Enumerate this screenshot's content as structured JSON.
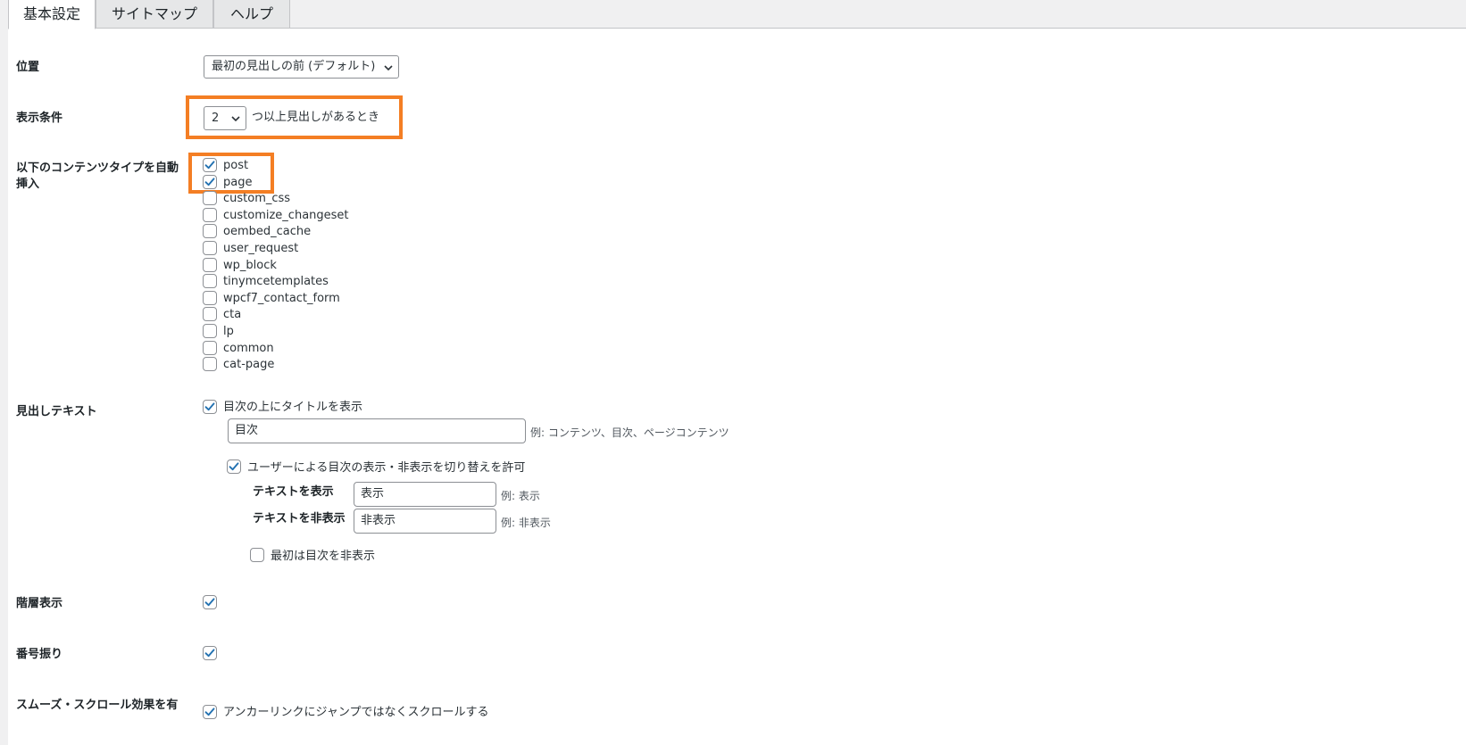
{
  "tabs": [
    "基本設定",
    "サイトマップ",
    "ヘルプ"
  ],
  "active_tab": "基本設定",
  "position": {
    "label": "位置",
    "selected": "最初の見出しの前 (デフォルト)"
  },
  "display_condition": {
    "label": "表示条件",
    "selected": "2",
    "suffix": "つ以上見出しがあるとき"
  },
  "content_types": {
    "label": "以下のコンテンツタイプを自動挿入",
    "items": [
      {
        "name": "post",
        "checked": true
      },
      {
        "name": "page",
        "checked": true
      },
      {
        "name": "custom_css",
        "checked": false
      },
      {
        "name": "customize_changeset",
        "checked": false
      },
      {
        "name": "oembed_cache",
        "checked": false
      },
      {
        "name": "user_request",
        "checked": false
      },
      {
        "name": "wp_block",
        "checked": false
      },
      {
        "name": "tinymcetemplates",
        "checked": false
      },
      {
        "name": "wpcf7_contact_form",
        "checked": false
      },
      {
        "name": "cta",
        "checked": false
      },
      {
        "name": "lp",
        "checked": false
      },
      {
        "name": "common",
        "checked": false
      },
      {
        "name": "cat-page",
        "checked": false
      }
    ]
  },
  "heading_text": {
    "label": "見出しテキスト",
    "show_title_label": "目次の上にタイトルを表示",
    "show_title_checked": true,
    "title_value": "目次",
    "title_hint": "例: コンテンツ、目次、ページコンテンツ",
    "toggle_label": "ユーザーによる目次の表示・非表示を切り替えを許可",
    "toggle_checked": true,
    "show_text_label": "テキストを表示",
    "show_text_value": "表示",
    "show_text_hint": "例: 表示",
    "hide_text_label": "テキストを非表示",
    "hide_text_value": "非表示",
    "hide_text_hint": "例: 非表示",
    "initially_hidden_label": "最初は目次を非表示",
    "initially_hidden_checked": false
  },
  "hierarchy": {
    "label": "階層表示",
    "checked": true
  },
  "numbering": {
    "label": "番号振り",
    "checked": true
  },
  "smooth_scroll": {
    "label": "スムーズ・スクロール効果を有",
    "option_label": "アンカーリンクにジャンプではなくスクロールする",
    "checked": true
  },
  "colors": {
    "accent": "#2271b1",
    "highlight": "#f47e24",
    "tab_bg": "#f0f0f1"
  },
  "icons": {
    "select_arrow": "chevron-down-icon",
    "check": "checkmark-icon"
  }
}
